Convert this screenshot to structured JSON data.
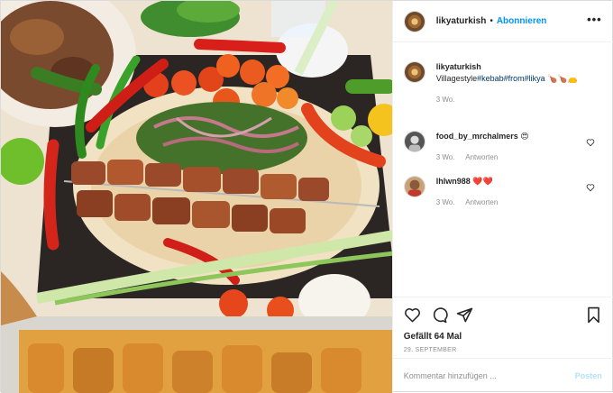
{
  "photo": {
    "alt": ""
  },
  "header": {
    "username": "likyaturkish",
    "separator": "•",
    "follow_label": "Abonnieren",
    "more_label": "•••"
  },
  "caption": {
    "username": "likyaturkish",
    "text_prefix": "Villagestyle",
    "tags": "#kebab#from#likya",
    "emoji": "🍗🍗👝",
    "time": "3 Wo."
  },
  "comments": [
    {
      "username": "food_by_mrchalmers",
      "text": "😍",
      "time": "3 Wo.",
      "reply_label": "Antworten"
    },
    {
      "username": "lhlwn988",
      "text": "❤️❤️",
      "time": "3 Wo.",
      "reply_label": "Antworten"
    }
  ],
  "actions": {
    "likes": "Gefällt 64 Mal",
    "date": "29. SEPTEMBER"
  },
  "comment_box": {
    "placeholder": "Kommentar hinzufügen ...",
    "post_label": "Posten"
  },
  "colors": {
    "link_blue": "#0095f6",
    "hashtag": "#00376b",
    "secondary_text": "#8e8e8e",
    "post_disabled": "#b2dffc"
  },
  "icons": [
    "heart-icon",
    "comment-icon",
    "share-icon",
    "bookmark-icon",
    "more-icon"
  ]
}
